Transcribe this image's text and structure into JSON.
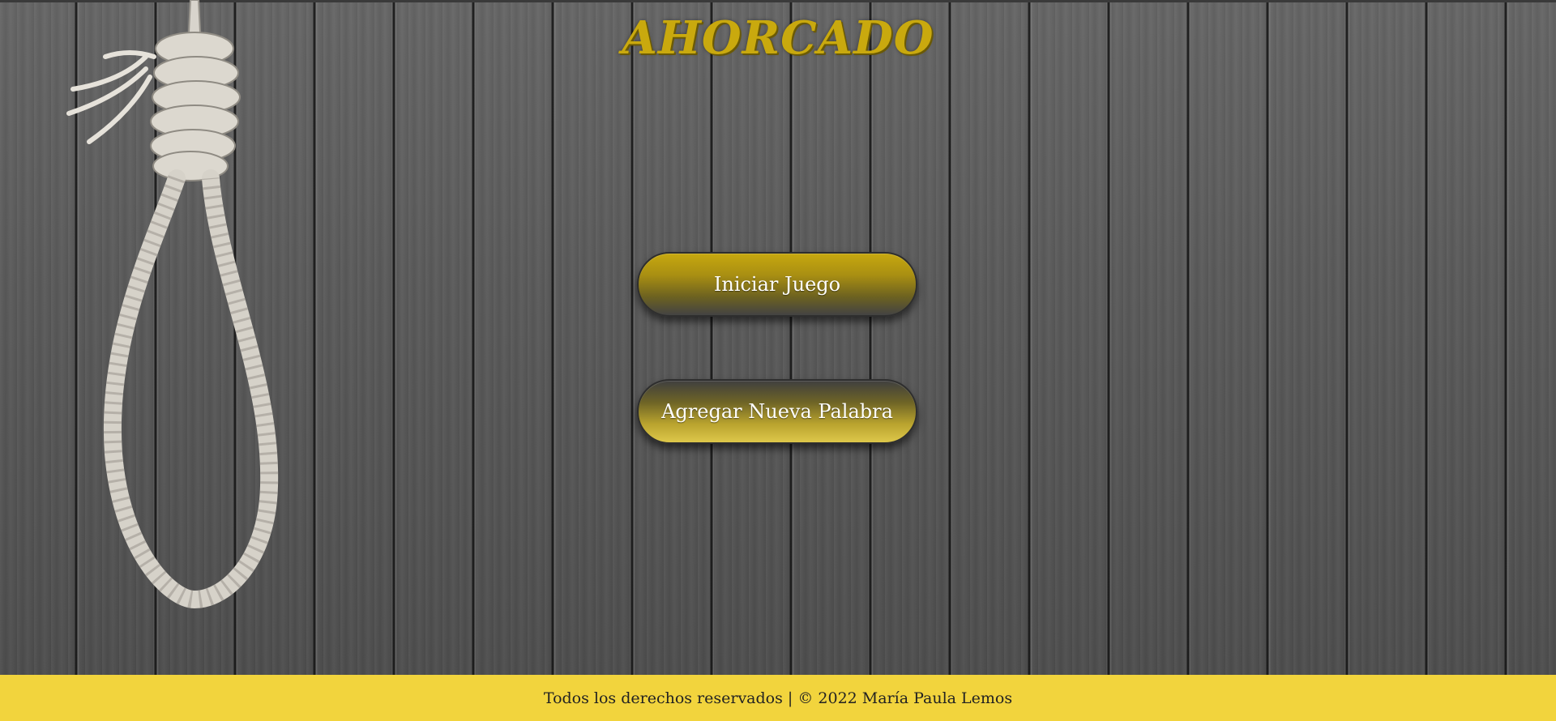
{
  "page": {
    "title": "AHORCADO"
  },
  "buttons": {
    "start_label": "Iniciar Juego",
    "add_word_label": "Agregar Nueva Palabra"
  },
  "footer": {
    "text": "Todos los derechos reservados | © 2022 María Paula Lemos"
  },
  "colors": {
    "accent": "#c9a90e",
    "footer_bg": "#f2d43d",
    "wall": "#5a5a5a"
  },
  "icons": {
    "background_illustration": "noose-rope-illustration"
  }
}
